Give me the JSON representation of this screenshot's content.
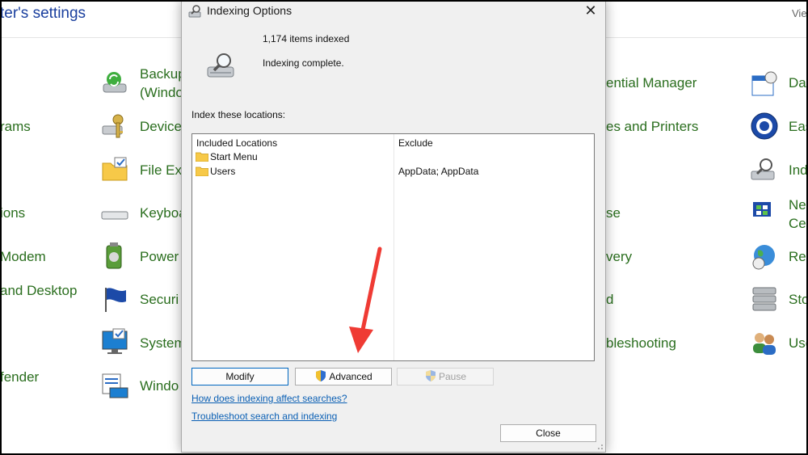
{
  "control_panel": {
    "title": "ter's settings",
    "view_label": "Vie",
    "items": [
      {
        "label": "Backup",
        "label2": "(Windo",
        "icon": "backup-icon"
      },
      {
        "label": "rams",
        "icon": ""
      },
      {
        "label": "Device",
        "icon": "keys-icon"
      },
      {
        "label": "File Exp",
        "icon": "file-explorer-icon"
      },
      {
        "label": "ions",
        "icon": ""
      },
      {
        "label": "Keyboa",
        "icon": "keyboard-icon"
      },
      {
        "label": "Modem",
        "icon": ""
      },
      {
        "label": "Power",
        "icon": "power-icon"
      },
      {
        "label": "and Desktop",
        "icon": ""
      },
      {
        "label": "Securi",
        "icon": "security-flag-icon"
      },
      {
        "label": "System",
        "icon": "system-icon"
      },
      {
        "label": "fender",
        "icon": ""
      },
      {
        "label": "Windo",
        "icon": "windows-tools-icon"
      },
      {
        "label": "ential Manager",
        "icon": ""
      },
      {
        "label": "es and Printers",
        "icon": ""
      },
      {
        "label": "se",
        "icon": ""
      },
      {
        "label": "very",
        "icon": ""
      },
      {
        "label": "d",
        "icon": ""
      },
      {
        "label": "bleshooting",
        "icon": ""
      },
      {
        "label": "Da",
        "icon": "date-time-icon"
      },
      {
        "label": "Eas",
        "icon": "ease-of-access-icon"
      },
      {
        "label": "Ind",
        "icon": "indexing-icon"
      },
      {
        "label": "Ne",
        "label2": "Cer",
        "icon": "network-icon"
      },
      {
        "label": "Reg",
        "icon": "region-icon"
      },
      {
        "label": "Sto",
        "icon": "storage-icon"
      },
      {
        "label": "Use",
        "icon": "user-accounts-icon"
      }
    ]
  },
  "dialog": {
    "title": "Indexing Options",
    "close_glyph": "✕",
    "items_indexed": "1,174 items indexed",
    "status": "Indexing complete.",
    "locations_label": "Index these locations:",
    "columns": [
      "Included Locations",
      "Exclude"
    ],
    "rows": [
      {
        "location": "Start Menu",
        "exclude": ""
      },
      {
        "location": "Users",
        "exclude": "AppData; AppData"
      }
    ],
    "buttons": {
      "modify": "Modify",
      "advanced": "Advanced",
      "pause": "Pause",
      "close": "Close"
    },
    "links": {
      "help": "How does indexing affect searches?",
      "troubleshoot": "Troubleshoot search and indexing"
    }
  },
  "colors": {
    "link_green": "#2a6e1e",
    "title_blue": "#1a3f9e",
    "dialog_link": "#0a5fb4",
    "arrow_red": "#ef3b34"
  }
}
